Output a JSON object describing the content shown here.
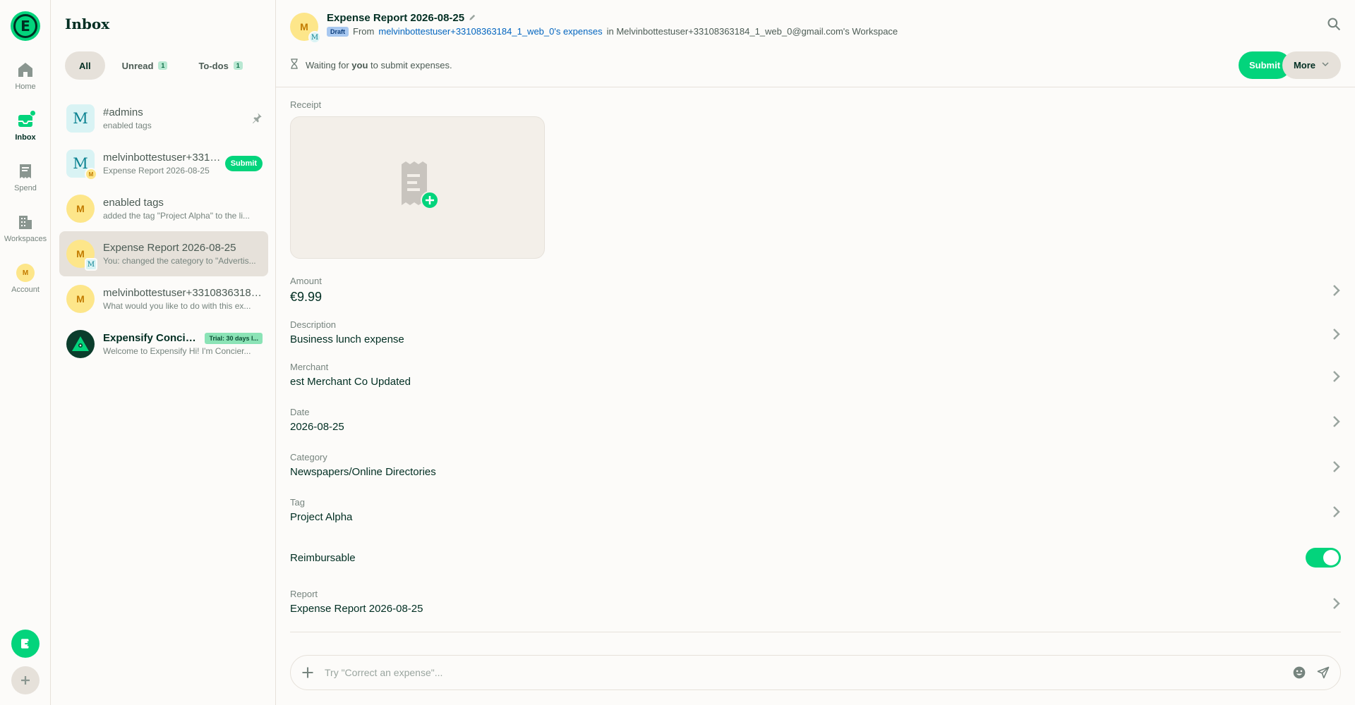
{
  "nav": {
    "logo_letter": "E",
    "items": [
      {
        "label": "Home",
        "icon": "home-icon"
      },
      {
        "label": "Inbox",
        "icon": "inbox-icon"
      },
      {
        "label": "Spend",
        "icon": "receipt-icon"
      },
      {
        "label": "Workspaces",
        "icon": "building-icon"
      },
      {
        "label": "Account",
        "icon": "avatar"
      }
    ],
    "account_initial": "M"
  },
  "inbox": {
    "title": "Inbox",
    "tabs": [
      {
        "label": "All"
      },
      {
        "label": "Unread",
        "count": "1"
      },
      {
        "label": "To-dos",
        "count": "1"
      }
    ],
    "rows": [
      {
        "avatar": "M",
        "title": "#admins",
        "subtitle": "enabled tags"
      },
      {
        "avatar": "M",
        "sub_avatar": "M",
        "title": "melvinbottestuser+3310...",
        "subtitle": "Expense Report 2026-08-25",
        "button": "Submit"
      },
      {
        "avatar": "M",
        "title": "enabled tags",
        "subtitle": "added the tag \"Project Alpha\" to the li..."
      },
      {
        "avatar": "M",
        "sub_avatar": "M",
        "title": "Expense Report 2026-08-25",
        "subtitle": "You: changed the category to \"Advertis..."
      },
      {
        "avatar": "M",
        "title": "melvinbottestuser+33108363184...",
        "subtitle": "What would you like to do with this ex..."
      },
      {
        "title": "Expensify Concierge",
        "badge": "Trial: 30 days l...",
        "subtitle": "Welcome to Expensify Hi! I'm Concier..."
      }
    ]
  },
  "header": {
    "avatar": "M",
    "sub_avatar": "M",
    "title": "Expense Report 2026-08-25",
    "badge": "Draft",
    "from_prefix": "From",
    "from_link": "melvinbottestuser+33108363184_1_web_0's expenses",
    "in_text": "in Melvinbottestuser+33108363184_1_web_0@gmail.com's Workspace",
    "status_pre": "Waiting for",
    "status_bold": "you",
    "status_post": "to submit expenses.",
    "submit_label": "Submit",
    "more_label": "More"
  },
  "expense": {
    "receipt_label": "Receipt",
    "amount_label": "Amount",
    "amount_value": "€9.99",
    "description_label": "Description",
    "description_value": "Business lunch expense",
    "merchant_label": "Merchant",
    "merchant_value": "est Merchant Co Updated",
    "date_label": "Date",
    "date_value": "2026-08-25",
    "category_label": "Category",
    "category_value": "Newspapers/Online Directories",
    "tag_label": "Tag",
    "tag_value": "Project Alpha",
    "reimbursable_label": "Reimbursable",
    "reimbursable_on": true,
    "report_label": "Report",
    "report_value": "Expense Report 2026-08-25"
  },
  "composer": {
    "placeholder": "Try \"Correct an expense\"..."
  },
  "colors": {
    "accent": "#03d47c",
    "text": "#002e22",
    "muted": "#76847e",
    "link": "#0164bf",
    "border": "#e6e1da"
  }
}
